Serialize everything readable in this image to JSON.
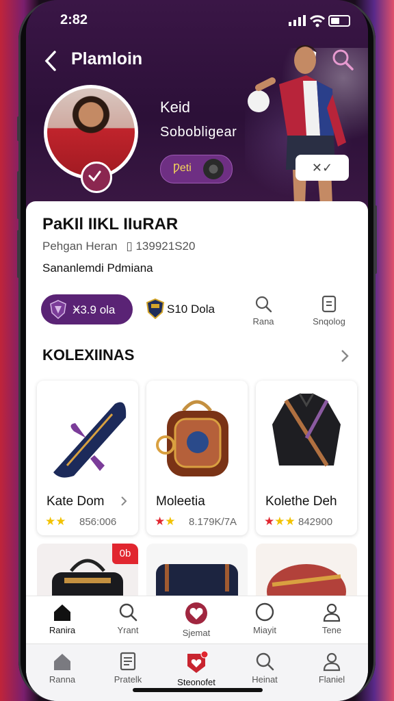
{
  "status": {
    "time": "2:82"
  },
  "header": {
    "title": "Plamloin"
  },
  "profile": {
    "name": "Keid",
    "subtitle": "Sobobligear",
    "action_label": "Ƿeti",
    "close_label": "✕✓"
  },
  "info": {
    "heading": "PaKIl IIKL IIuRAR",
    "meta_label": "Pehgan Heran",
    "meta_value": "139921S20",
    "description": "Sananlemdi Pdmiana"
  },
  "chips": [
    {
      "label": "Ӿ3.9 ola"
    },
    {
      "label": "S10 Dola"
    }
  ],
  "quick_actions": [
    {
      "label": "Rana",
      "icon": "search-icon"
    },
    {
      "label": "Snqolog",
      "icon": "document-icon"
    }
  ],
  "section": {
    "title": "KOLEXIINAS"
  },
  "products": [
    {
      "name": "Kate Dom",
      "price": "856:006",
      "stars": "★★",
      "star_colors": [
        "#f2c200",
        "#f2c200"
      ]
    },
    {
      "name": "Moleetia",
      "price": "8.179K/7A",
      "stars": "★★",
      "star_colors": [
        "#e1262f",
        "#f2c200"
      ]
    },
    {
      "name": "Kolethe Deh",
      "price": "842900",
      "stars": "★★★",
      "star_colors": [
        "#e1262f",
        "#f2c200",
        "#f2c200"
      ]
    }
  ],
  "sale_badge": "0b",
  "tabs_primary": [
    {
      "label": "Ranira",
      "icon": "home-icon",
      "active": true
    },
    {
      "label": "Yrant",
      "icon": "search-icon"
    },
    {
      "label": "Sjemat",
      "icon": "heart-icon"
    },
    {
      "label": "Miayit",
      "icon": "circle-icon"
    },
    {
      "label": "Tene",
      "icon": "user-icon"
    }
  ],
  "tabs_secondary": [
    {
      "label": "Ranna",
      "icon": "home-icon"
    },
    {
      "label": "Pratelk",
      "icon": "list-icon"
    },
    {
      "label": "Steonofet",
      "icon": "shield-heart-icon",
      "badge": "1"
    },
    {
      "label": "Heinat",
      "icon": "search-icon"
    },
    {
      "label": "Flaniel",
      "icon": "user-icon"
    }
  ],
  "colors": {
    "accent": "#5a2375",
    "brand_red": "#e1262f",
    "hero_bg": "#2c1038"
  }
}
